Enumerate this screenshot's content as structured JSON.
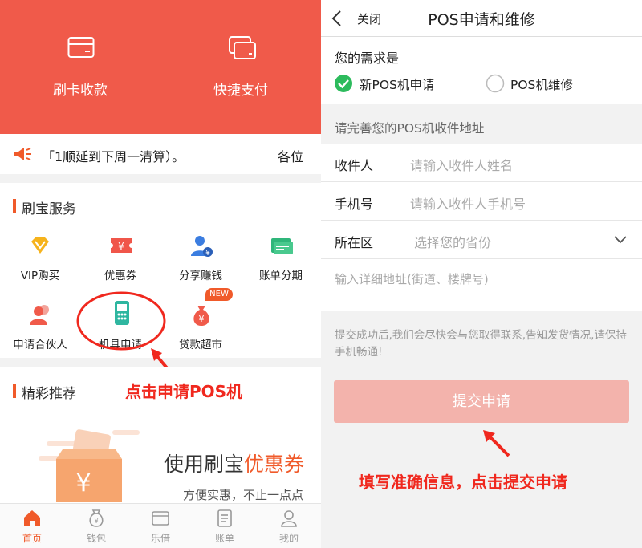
{
  "left": {
    "hero": {
      "card_pay": "刷卡收款",
      "quick_pay": "快捷支付"
    },
    "notice": {
      "text": "「1顺延到下周一清算）。",
      "text_right": "各位"
    },
    "services": {
      "title": "刷宝服务",
      "items": [
        {
          "label": "VIP购买",
          "icon": "diamond-icon"
        },
        {
          "label": "优惠券",
          "icon": "coupon-icon"
        },
        {
          "label": "分享赚钱",
          "icon": "share-money-icon"
        },
        {
          "label": "账单分期",
          "icon": "bill-installment-icon"
        },
        {
          "label": "申请合伙人",
          "icon": "partner-icon"
        },
        {
          "label": "机具申请",
          "icon": "pos-machine-icon"
        },
        {
          "label": "贷款超市",
          "icon": "loan-bag-icon",
          "badge": "NEW"
        }
      ]
    },
    "annotation": "点击申请POS机",
    "recommend": {
      "title": "精彩推荐",
      "banner_title_a": "使用刷宝",
      "banner_title_b": "优惠券",
      "banner_sub": "方便实惠，不止一点点"
    },
    "tabbar": [
      {
        "label": "首页",
        "icon": "home-icon",
        "active": true
      },
      {
        "label": "钱包",
        "icon": "wallet-icon",
        "active": false
      },
      {
        "label": "乐借",
        "icon": "borrow-icon",
        "active": false
      },
      {
        "label": "账单",
        "icon": "bill-icon",
        "active": false
      },
      {
        "label": "我的",
        "icon": "user-icon",
        "active": false
      }
    ],
    "colors": {
      "brand": "#f05a4a",
      "accent": "#f05a2a",
      "annotation": "#f0281e"
    }
  },
  "right": {
    "nav": {
      "close": "关闭",
      "title": "POS申请和维修"
    },
    "requirement": {
      "label": "您的需求是",
      "options": [
        {
          "label": "新POS机申请",
          "checked": true
        },
        {
          "label": "POS机维修",
          "checked": false
        }
      ]
    },
    "address_header": "请完善您的POS机收件地址",
    "form": {
      "recipient_label": "收件人",
      "recipient_placeholder": "请输入收件人姓名",
      "phone_label": "手机号",
      "phone_placeholder": "请输入收件人手机号",
      "region_label": "所在区",
      "region_placeholder": "选择您的省份",
      "detail_placeholder": "输入详细地址(街道、楼牌号)"
    },
    "tip": "提交成功后,我们会尽快会与您取得联系,告知发货情况,请保持手机畅通!",
    "submit": "提交申请",
    "annotation": "填写准确信息，点击提交申请",
    "colors": {
      "check": "#2dbb5d",
      "submit": "#f3b3ac"
    }
  }
}
